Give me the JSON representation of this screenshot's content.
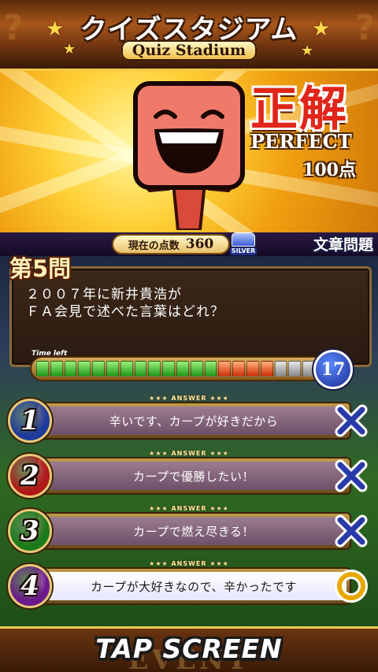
{
  "header": {
    "title_jp": "クイズスタジアム",
    "title_en": "Quiz Stadium",
    "decor_left": "?",
    "decor_right": "?"
  },
  "result": {
    "verdict": "正解",
    "rating": "PERFECT",
    "points": "100点"
  },
  "scorebar": {
    "label": "現在の点数",
    "value": "360",
    "badge": "SILVER",
    "category": "文章問題"
  },
  "question": {
    "number": "第5問",
    "lines": [
      "２００７年に新井貴浩が",
      "ＦＡ会見で述べた言葉はどれ？"
    ]
  },
  "timer": {
    "label": "Time left",
    "seconds": "17",
    "segments_total": 20,
    "segments_green": 13,
    "segments_red": 4,
    "segments_grey": 3
  },
  "answers": [
    {
      "num": "1",
      "tag": "★★★ ANSWER ★★★",
      "text": "辛いです、カープが好きだから",
      "result": "wrong",
      "color": "#1e3a9a"
    },
    {
      "num": "2",
      "tag": "★★★ ANSWER ★★★",
      "text": "カープで優勝したい！",
      "result": "wrong",
      "color": "#b01818"
    },
    {
      "num": "3",
      "tag": "★★★ ANSWER ★★★",
      "text": "カープで燃え尽きる！",
      "result": "wrong",
      "color": "#1a7a1a"
    },
    {
      "num": "4",
      "tag": "★★★ ANSWER ★★★",
      "text": "カープが大好きなので、辛かったです",
      "result": "correct",
      "color": "#6a1a8a"
    }
  ],
  "footer": {
    "tap": "TAP SCREEN",
    "event": "EVENT"
  },
  "colors": {
    "wrong_mark": "#2a3aa8",
    "correct_mark": "#e8a800",
    "verdict": "#e0261a"
  }
}
